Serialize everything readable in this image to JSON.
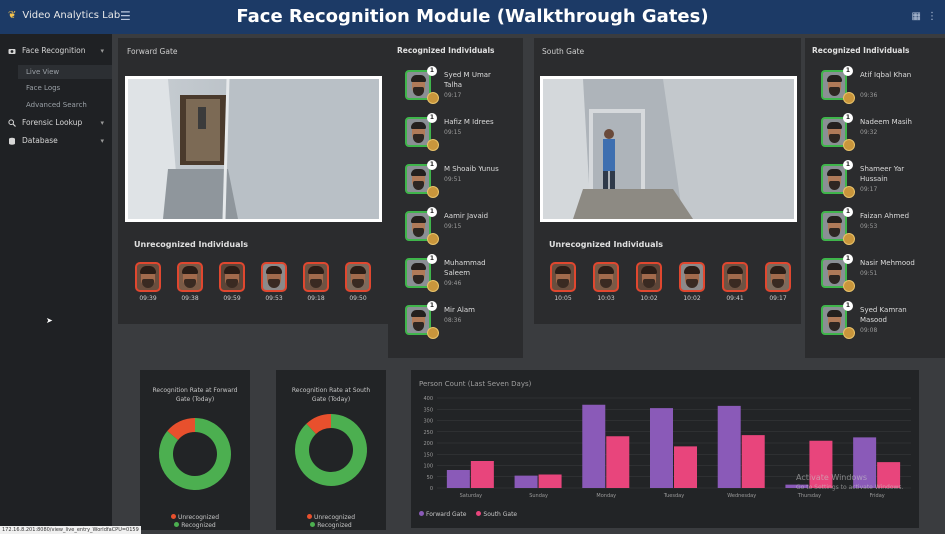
{
  "header": {
    "brand": "Video Analytics Lab",
    "brand_icon": "leaf-icon",
    "title": "Face Recognition Module (Walkthrough Gates)",
    "colors": {
      "bar": "#1c3a66"
    }
  },
  "sidebar": {
    "items": [
      {
        "label": "Face Recognition",
        "icon": "camera-icon",
        "expanded": true
      },
      {
        "label": "Forensic Lookup",
        "icon": "magnify-icon"
      },
      {
        "label": "Database",
        "icon": "database-icon"
      }
    ],
    "subitems": [
      {
        "label": "Live View",
        "active": true
      },
      {
        "label": "Face Logs"
      },
      {
        "label": "Advanced Search"
      }
    ]
  },
  "forward": {
    "title": "Forward Gate",
    "unrec_title": "Unrecognized Individuals",
    "unrec_times": [
      "09:39",
      "09:38",
      "09:59",
      "09:53",
      "09:18",
      "09:50"
    ],
    "rec_title": "Recognized Individuals",
    "recognized": [
      {
        "rank": "1",
        "name": "Syed M Umar Talha",
        "time": "09:17"
      },
      {
        "rank": "1",
        "name": "Hafiz M Idrees",
        "time": "09:15"
      },
      {
        "rank": "1",
        "name": "M Shoaib Yunus",
        "time": "09:51"
      },
      {
        "rank": "1",
        "name": "Aamir Javaid",
        "time": "09:15"
      },
      {
        "rank": "1",
        "name": "Muhammad Saleem",
        "time": "09:46"
      },
      {
        "rank": "1",
        "name": "Mir Alam",
        "time": "08:36"
      }
    ]
  },
  "south": {
    "title": "South Gate",
    "unrec_title": "Unrecognized Individuals",
    "unrec_times": [
      "10:05",
      "10:03",
      "10:02",
      "10:02",
      "09:41",
      "09:17"
    ],
    "rec_title": "Recognized Individuals",
    "recognized": [
      {
        "rank": "1",
        "name": "Atif Iqbal Khan",
        "time": "09:36"
      },
      {
        "rank": "1",
        "name": "Nadeem Masih",
        "time": "09:32"
      },
      {
        "rank": "1",
        "name": "Shameer Yar Hussain",
        "time": "09:17"
      },
      {
        "rank": "1",
        "name": "Faizan Ahmed",
        "time": "09:53"
      },
      {
        "rank": "1",
        "name": "Nasir Mehmood",
        "time": "09:51"
      },
      {
        "rank": "1",
        "name": "Syed Kamran Masood",
        "time": "09:08"
      }
    ]
  },
  "donuts": [
    {
      "title": "Recognition Rate at Forward Gate (Today)",
      "legend": [
        "Unrecognized",
        "Recognized"
      ]
    },
    {
      "title": "Recognition Rate at South Gate (Today)",
      "legend": [
        "Unrecognized",
        "Recognized"
      ]
    }
  ],
  "bar_section": {
    "title": "Person Count (Last Seven Days)",
    "legend": [
      "Forward Gate",
      "South Gate"
    ]
  },
  "chart_data": [
    {
      "type": "pie",
      "title": "Recognition Rate at Forward Gate (Today)",
      "labels": [
        "Unrecognized",
        "Recognized"
      ],
      "values": [
        14,
        86
      ],
      "colors": [
        "#e8502d",
        "#4caf50"
      ]
    },
    {
      "type": "pie",
      "title": "Recognition Rate at South Gate (Today)",
      "labels": [
        "Unrecognized",
        "Recognized"
      ],
      "values": [
        12,
        88
      ],
      "colors": [
        "#e8502d",
        "#4caf50"
      ]
    },
    {
      "type": "bar",
      "title": "Person Count (Last Seven Days)",
      "categories": [
        "Saturday",
        "Sunday",
        "Monday",
        "Tuesday",
        "Wednesday",
        "Thursday",
        "Friday"
      ],
      "series": [
        {
          "name": "Forward Gate",
          "values": [
            80,
            55,
            370,
            355,
            365,
            15,
            225
          ],
          "color": "#8a5ab8"
        },
        {
          "name": "South Gate",
          "values": [
            120,
            60,
            230,
            185,
            235,
            210,
            115
          ],
          "color": "#e8457c"
        }
      ],
      "yticks": [
        "0",
        "50",
        "100",
        "150",
        "200",
        "250",
        "300",
        "350",
        "400"
      ],
      "ylim": [
        0,
        400
      ],
      "grid": true,
      "legend_position": "bottom-left"
    }
  ],
  "watermark": {
    "line1": "Activate Windows",
    "line2": "Go to Settings to activate Windows."
  },
  "status_url": "172.16.8.201:8080/view_live_entry_WorldfaCPU=0159"
}
